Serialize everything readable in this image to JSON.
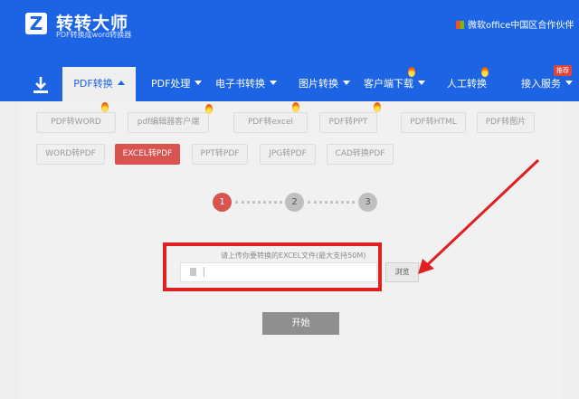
{
  "header": {
    "logo_letter": "Z",
    "brand_name": "转转大师",
    "brand_subtitle": "PDF转换成word转换器",
    "partner_text": "微软office中国区合作伙伴",
    "new_badge": "推荐"
  },
  "nav": {
    "items": [
      {
        "label": "PDF转换"
      },
      {
        "label": "PDF处理"
      },
      {
        "label": "电子书转换"
      },
      {
        "label": "图片转换"
      },
      {
        "label": "客户端下载"
      },
      {
        "label": "人工转换"
      },
      {
        "label": "接入服务"
      }
    ]
  },
  "subtabs": {
    "row1": [
      "PDF转WORD",
      "pdf编辑器客户端",
      "PDF转excel",
      "PDF转PPT",
      "PDF转HTML",
      "PDF转图片"
    ],
    "row2": [
      "WORD转PDF",
      "EXCEL转PDF",
      "PPT转PDF",
      "JPG转PDF",
      "CAD转换PDF"
    ]
  },
  "steps": [
    "1",
    "2",
    "3"
  ],
  "upload": {
    "hint": "请上传你要转换的EXCEL文件(最大支持50M)",
    "browse_label": "浏览",
    "start_label": "开始"
  },
  "colors": {
    "header_blue": "#1c64e4",
    "accent_red": "#d9534f",
    "highlight_red": "#e02020"
  }
}
